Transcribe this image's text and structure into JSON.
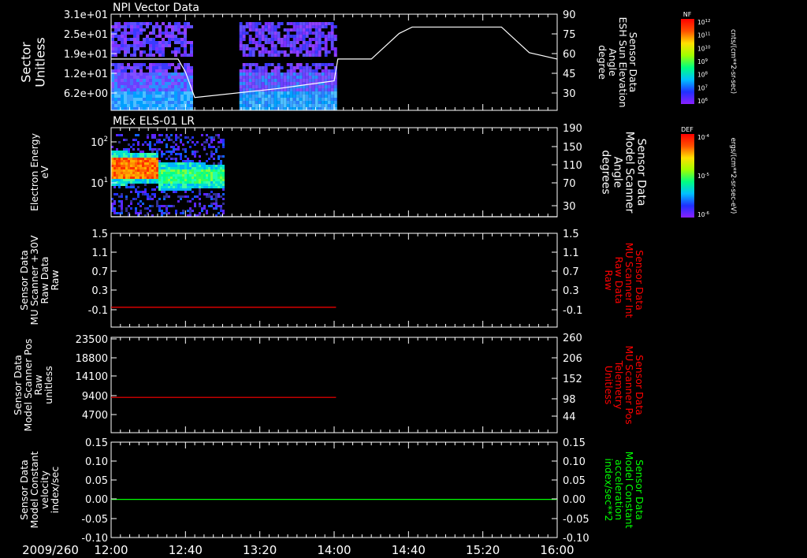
{
  "chart_data": [
    {
      "type": "heatmap",
      "title": "NPI Vector Data",
      "ylabel": [
        "Sector",
        "Unitless"
      ],
      "y_ticks": [
        "3.1e+01",
        "2.5e+01",
        "1.9e+01",
        "1.2e+01",
        "6.2e+00"
      ],
      "y2label": [
        "Sensor Data",
        "ESH Sun Elevation",
        "Angle",
        "degree"
      ],
      "y2_ticks": [
        "90",
        "75",
        "60",
        "45",
        "30"
      ],
      "ylim2": [
        15,
        90
      ],
      "data_spans": [
        [
          "12:00",
          "12:44"
        ],
        [
          "13:09",
          "14:01"
        ]
      ],
      "colorbar": {
        "label": "NF",
        "unit": "cnts/(cm**2-sr-sec)",
        "ticks": [
          "10^12",
          "10^11",
          "10^10",
          "10^9",
          "10^8",
          "10^7",
          "10^6"
        ]
      },
      "series": [
        {
          "name": "ESH Sun Elevation Angle",
          "color": "#ffffff",
          "points": [
            [
              "12:00",
              55
            ],
            [
              "12:36",
              55
            ],
            [
              "12:40",
              45
            ],
            [
              "12:45",
              25
            ],
            [
              "13:30",
              32
            ],
            [
              "14:00",
              38
            ],
            [
              "14:02",
              55
            ],
            [
              "14:20",
              55
            ],
            [
              "14:35",
              75
            ],
            [
              "14:42",
              80
            ],
            [
              "15:30",
              80
            ],
            [
              "15:45",
              60
            ],
            [
              "16:00",
              55
            ]
          ]
        }
      ]
    },
    {
      "type": "heatmap",
      "title": "MEx ELS-01 LR",
      "ylabel": [
        "Electron Energy",
        "eV"
      ],
      "y_ticks": [
        "10^2",
        "10^1"
      ],
      "y2label": [
        "Sensor Data",
        "Model Scanner",
        "Angle",
        "degrees"
      ],
      "y2_ticks": [
        "190",
        "150",
        "110",
        "70",
        "30"
      ],
      "ylim2": [
        10,
        190
      ],
      "data_spans": [
        [
          "12:00",
          "13:00"
        ]
      ],
      "colorbar": {
        "label": "DEF",
        "unit": "ergs/(cm**2-sr-sec-eV)",
        "ticks": [
          "10^-4",
          "10^-5",
          "10^-6"
        ]
      },
      "series": [
        {
          "name": "Model Scanner Angle",
          "color": "#ffffff",
          "points": [
            [
              "12:00",
              10
            ],
            [
              "16:00",
              10
            ]
          ]
        }
      ]
    },
    {
      "type": "line",
      "ylabel": [
        "Sensor Data",
        "MU Scanner +30V",
        "Raw Data",
        "Raw"
      ],
      "y_ticks": [
        "1.5",
        "1.1",
        "0.7",
        "0.3",
        "-0.1"
      ],
      "ylim": [
        -0.4,
        1.5
      ],
      "y2label": [
        "Sensor Data",
        "MU Scanner Int",
        "Raw Data",
        "Raw"
      ],
      "y2_ticks": [
        "1.5",
        "1.1",
        "0.7",
        "0.3",
        "-0.1"
      ],
      "y2_color": "#ff0000",
      "series": [
        {
          "name": "MU Scanner Int Raw Data",
          "color": "#ff0000",
          "points": [
            [
              "12:00",
              0.0
            ],
            [
              "14:01",
              0.0
            ]
          ]
        }
      ]
    },
    {
      "type": "line",
      "ylabel": [
        "Sensor Data",
        "Model Scanner Pos",
        "Raw",
        "unitless"
      ],
      "y_ticks": [
        "23500",
        "18800",
        "14100",
        "9400",
        "4700"
      ],
      "y2label": [
        "Sensor Data",
        "MU Scanner Pos",
        "Telemetry",
        "Unitless"
      ],
      "y2_ticks": [
        "260",
        "206",
        "152",
        "98",
        "44"
      ],
      "ylim2": [
        -10,
        260
      ],
      "y2_color": "#ff0000",
      "series": [
        {
          "name": "MU Scanner Pos Telemetry",
          "color": "#ff0000",
          "points": [
            [
              "12:00",
              90
            ],
            [
              "14:01",
              90
            ]
          ]
        }
      ]
    },
    {
      "type": "line",
      "ylabel": [
        "Sensor Data",
        "Model Constant",
        "velocity",
        "index/sec"
      ],
      "y_ticks": [
        "0.15",
        "0.10",
        "0.05",
        "0.00",
        "-0.05",
        "-0.10"
      ],
      "ylim": [
        -0.1,
        0.15
      ],
      "y2label": [
        "Sensor Data",
        "Model Constant",
        "acceleration",
        "index/sec**2"
      ],
      "y2_ticks": [
        "0.15",
        "0.10",
        "0.05",
        "0.00",
        "-0.05",
        "-0.10"
      ],
      "y2_color": "#00ff00",
      "series": [
        {
          "name": "Model Constant acceleration",
          "color": "#00ff00",
          "points": [
            [
              "12:00",
              0.0
            ],
            [
              "16:00",
              0.0
            ]
          ]
        }
      ]
    }
  ],
  "x_axis": {
    "date_label": "2009/260",
    "ticks": [
      "12:00",
      "12:40",
      "13:20",
      "14:00",
      "14:40",
      "15:20",
      "16:00"
    ],
    "xlim": [
      "12:00",
      "16:00"
    ]
  }
}
